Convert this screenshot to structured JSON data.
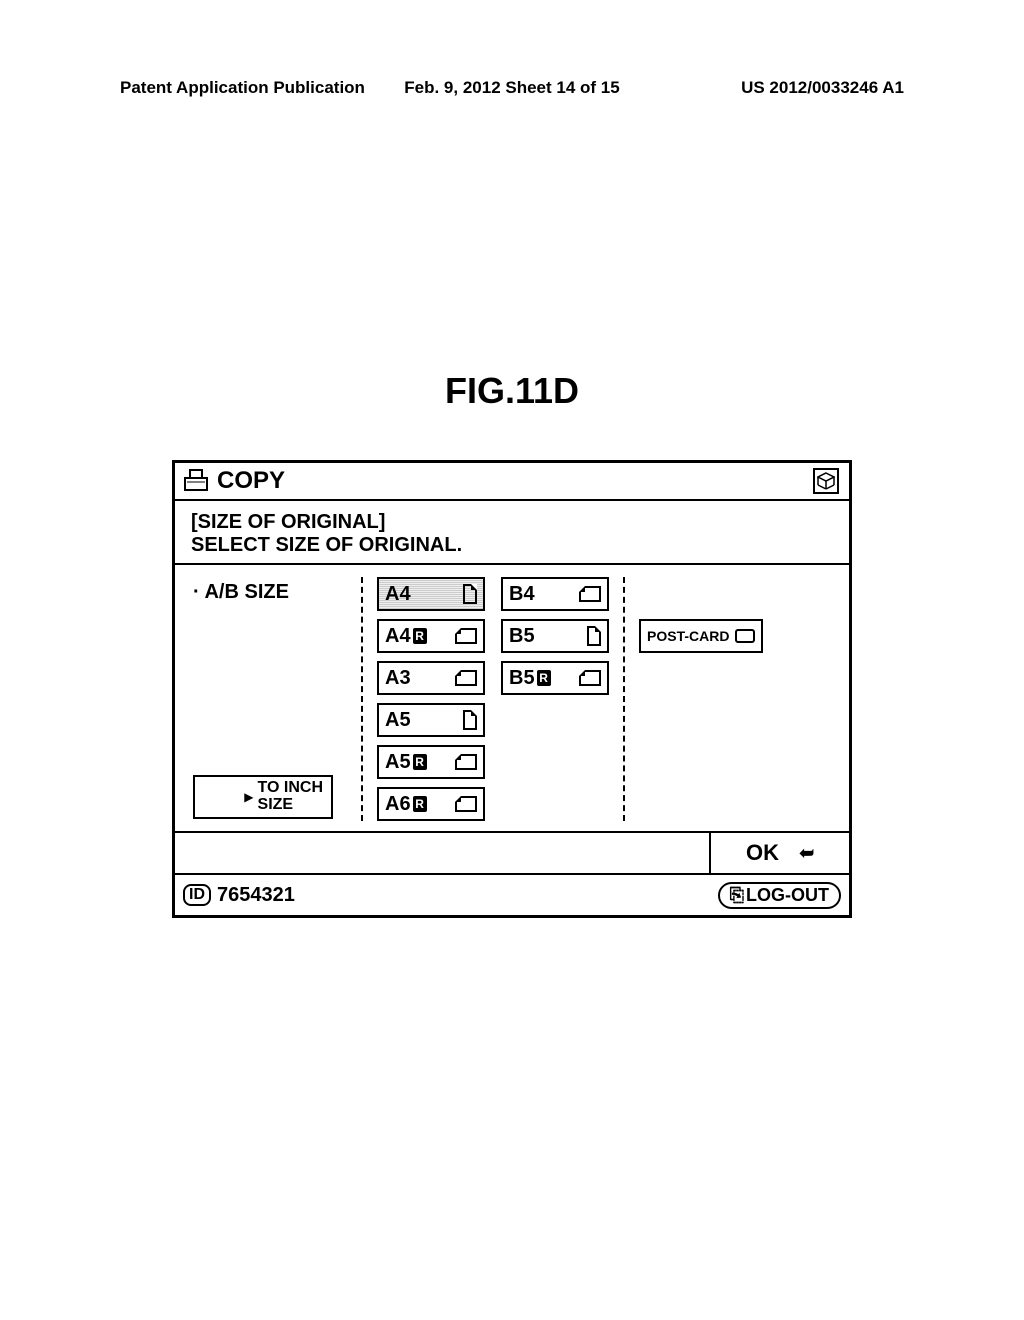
{
  "header": {
    "left": "Patent Application Publication",
    "mid": "Feb. 9, 2012  Sheet 14 of 15",
    "right": "US 2012/0033246 A1"
  },
  "figure_label": "FIG.11D",
  "titlebar": {
    "title": "COPY"
  },
  "instruction": {
    "line1": "[SIZE OF ORIGINAL]",
    "line2": "SELECT SIZE OF ORIGINAL."
  },
  "category": "· A/B SIZE",
  "to_inch": {
    "line1": "TO INCH",
    "line2": "SIZE"
  },
  "sizes_col1": [
    {
      "label": "A4",
      "r": false,
      "orient": "portrait",
      "selected": true
    },
    {
      "label": "A4",
      "r": true,
      "orient": "landscape",
      "selected": false
    },
    {
      "label": "A3",
      "r": false,
      "orient": "landscape",
      "selected": false
    },
    {
      "label": "A5",
      "r": false,
      "orient": "portrait",
      "selected": false
    },
    {
      "label": "A5",
      "r": true,
      "orient": "landscape",
      "selected": false
    },
    {
      "label": "A6",
      "r": true,
      "orient": "landscape",
      "selected": false
    }
  ],
  "sizes_col2": [
    {
      "label": "B4",
      "r": false,
      "orient": "landscape",
      "selected": false
    },
    {
      "label": "B5",
      "r": false,
      "orient": "portrait",
      "selected": false
    },
    {
      "label": "B5",
      "r": true,
      "orient": "landscape",
      "selected": false
    }
  ],
  "postcard": "POST-CARD",
  "ok": "OK",
  "status": {
    "id_badge": "ID",
    "id_number": "7654321",
    "logout": "LOG-OUT"
  }
}
